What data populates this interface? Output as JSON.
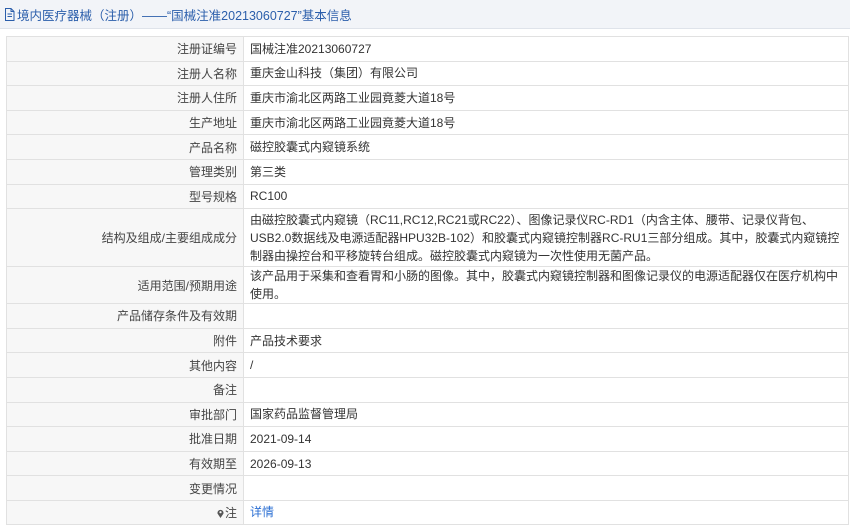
{
  "header": {
    "title": "境内医疗器械（注册）——“国械注准20213060727”基本信息",
    "icon": "document-icon"
  },
  "rows": [
    {
      "label": "注册证编号",
      "value": "国械注准20213060727"
    },
    {
      "label": "注册人名称",
      "value": "重庆金山科技（集团）有限公司"
    },
    {
      "label": "注册人住所",
      "value": "重庆市渝北区两路工业园竟菱大道18号"
    },
    {
      "label": "生产地址",
      "value": "重庆市渝北区两路工业园竟菱大道18号"
    },
    {
      "label": "产品名称",
      "value": "磁控胶囊式内窥镜系统"
    },
    {
      "label": "管理类别",
      "value": "第三类"
    },
    {
      "label": "型号规格",
      "value": "RC100"
    },
    {
      "label": "结构及组成/主要组成成分",
      "value": "由磁控胶囊式内窥镜（RC11,RC12,RC21或RC22）、图像记录仪RC-RD1（内含主体、腰带、记录仪背包、USB2.0数据线及电源适配器HPU32B-102）和胶囊式内窥镜控制器RC-RU1三部分组成。其中，胶囊式内窥镜控制器由操控台和平移旋转台组成。磁控胶囊式内窥镜为一次性使用无菌产品。"
    },
    {
      "label": "适用范围/预期用途",
      "value": "该产品用于采集和查看胃和小肠的图像。其中，胶囊式内窥镜控制器和图像记录仪的电源适配器仅在医疗机构中使用。"
    },
    {
      "label": "产品储存条件及有效期",
      "value": ""
    },
    {
      "label": "附件",
      "value": "产品技术要求"
    },
    {
      "label": "其他内容",
      "value": "/"
    },
    {
      "label": "备注",
      "value": ""
    },
    {
      "label": "审批部门",
      "value": "国家药品监督管理局"
    },
    {
      "label": "批准日期",
      "value": "2021-09-14"
    },
    {
      "label": "有效期至",
      "value": "2026-09-13"
    },
    {
      "label": "变更情况",
      "value": ""
    }
  ],
  "note": {
    "label": "注",
    "icon": "map-pin-icon",
    "link_text": "详情"
  },
  "colors": {
    "header_bg": "#f2f4f8",
    "header_text": "#2b5eab",
    "label_bg": "#f7f7f7",
    "link": "#2b6fd3",
    "border": "#e1e1e1"
  }
}
